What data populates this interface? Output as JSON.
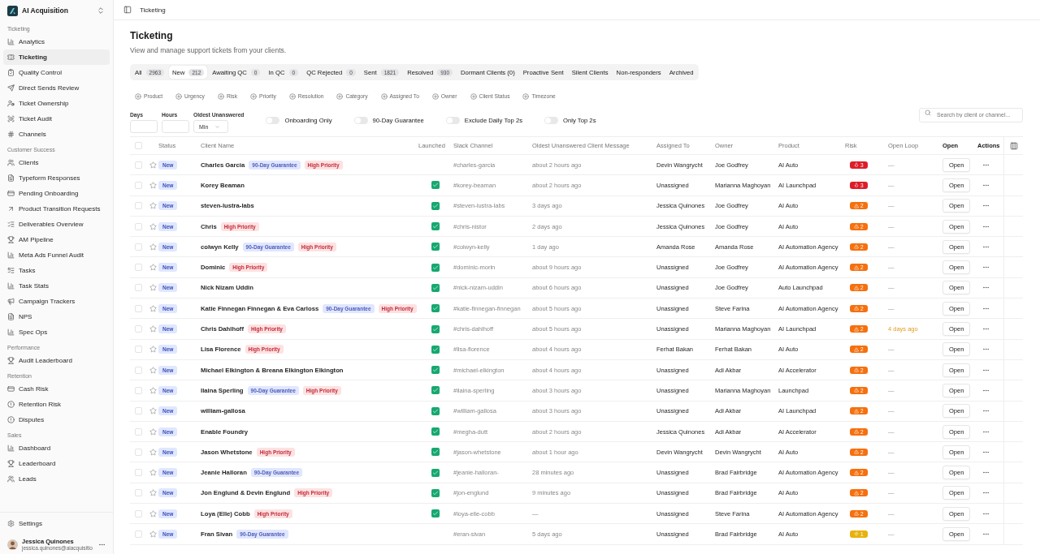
{
  "workspace": {
    "name": "AI Acquisition"
  },
  "breadcrumb": "Ticketing",
  "sidebar": {
    "sections": [
      {
        "title": "Ticketing",
        "items": [
          {
            "label": "Analytics",
            "selected": false
          },
          {
            "label": "Ticketing",
            "selected": true
          },
          {
            "label": "Quality Control",
            "selected": false
          },
          {
            "label": "Direct Sends Review",
            "selected": false
          },
          {
            "label": "Ticket Ownership",
            "selected": false
          },
          {
            "label": "Ticket Audit",
            "selected": false
          },
          {
            "label": "Channels",
            "selected": false
          }
        ]
      },
      {
        "title": "Customer Success",
        "items": [
          {
            "label": "Clients",
            "selected": false
          },
          {
            "label": "Typeform Responses",
            "selected": false
          },
          {
            "label": "Pending Onboarding",
            "selected": false
          },
          {
            "label": "Product Transition Requests",
            "selected": false
          },
          {
            "label": "Deliverables Overview",
            "selected": false
          },
          {
            "label": "AM Pipeline",
            "selected": false
          },
          {
            "label": "Meta Ads Funnel Audit",
            "selected": false
          },
          {
            "label": "Tasks",
            "selected": false
          },
          {
            "label": "Task Stats",
            "selected": false
          },
          {
            "label": "Campaign Trackers",
            "selected": false
          },
          {
            "label": "NPS",
            "selected": false
          },
          {
            "label": "Spec Ops",
            "selected": false
          }
        ]
      },
      {
        "title": "Performance",
        "items": [
          {
            "label": "Audit Leaderboard",
            "selected": false
          }
        ]
      },
      {
        "title": "Retention",
        "items": [
          {
            "label": "Cash Risk",
            "selected": false
          },
          {
            "label": "Retention Risk",
            "selected": false
          },
          {
            "label": "Disputes",
            "selected": false
          }
        ]
      },
      {
        "title": "Sales",
        "items": [
          {
            "label": "Dashboard",
            "selected": false
          },
          {
            "label": "Leaderboard",
            "selected": false
          },
          {
            "label": "Leads",
            "selected": false
          }
        ]
      }
    ],
    "settings": "Settings",
    "user": {
      "name": "Jessica Quinones",
      "email": "jessica.quinones@aiacquisitio"
    }
  },
  "page": {
    "title": "Ticketing",
    "subtitle": "View and manage support tickets from your clients."
  },
  "tabs": [
    {
      "label": "All",
      "count": "2963",
      "selected": false
    },
    {
      "label": "New",
      "count": "212",
      "selected": true
    },
    {
      "label": "Awaiting QC",
      "count": "0",
      "selected": false
    },
    {
      "label": "In QC",
      "count": "0",
      "selected": false
    },
    {
      "label": "QC Rejected",
      "count": "0",
      "selected": false
    },
    {
      "label": "Sent",
      "count": "1821",
      "selected": false
    },
    {
      "label": "Resolved",
      "count": "930",
      "selected": false
    },
    {
      "label": "Dormant Clients (0)",
      "selected": false
    },
    {
      "label": "Proactive Sent",
      "selected": false
    },
    {
      "label": "Silent Clients",
      "selected": false
    },
    {
      "label": "Non-responders",
      "selected": false
    },
    {
      "label": "Archived",
      "selected": false
    }
  ],
  "filters": [
    "Product",
    "Urgency",
    "Risk",
    "Priority",
    "Resolution",
    "Category",
    "Assigned To",
    "Owner",
    "Client Status",
    "Timezone"
  ],
  "range": {
    "days_label": "Days",
    "hours_label": "Hours",
    "oldest_label": "Oldest Unanswered",
    "oldest_value": "Min"
  },
  "toggles": [
    {
      "label": "Onboarding Only",
      "on": false
    },
    {
      "label": "90-Day Guarantee",
      "on": false
    },
    {
      "label": "Exclude Daily Top 2s",
      "on": false
    },
    {
      "label": "Only Top 2s",
      "on": false
    }
  ],
  "search": {
    "placeholder": "Search by client or channel..."
  },
  "table": {
    "select_all": false,
    "columns": [
      "Status",
      "Client Name",
      "Launched",
      "Slack Channel",
      "Oldest Unanswered Client Message",
      "Assigned To",
      "Owner",
      "Product",
      "Risk",
      "Open Loop",
      "Open",
      "Actions"
    ],
    "rows": [
      {
        "selected": false,
        "starred": false,
        "status": "New",
        "name": "Charles Garcia",
        "tags": [
          {
            "label": "90-Day Guarantee",
            "kind": "guarantee"
          },
          {
            "label": "High Priority",
            "kind": "priority"
          }
        ],
        "launched": false,
        "channel": "#charles-garcia",
        "oldest": "about 2 hours ago",
        "assigned": "Devin Wangrycht",
        "owner": "Joe Godfrey",
        "product": "AI Auto",
        "risk": {
          "kind": "critical",
          "value": "3"
        },
        "open_loop": {
          "text": "—",
          "overdue": false
        },
        "action": "Open"
      },
      {
        "selected": false,
        "starred": false,
        "status": "New",
        "name": "Korey Beaman",
        "tags": [],
        "launched": true,
        "channel": "#korey-beaman",
        "oldest": "about 2 hours ago",
        "assigned": "Unassigned",
        "owner": "Marianna Maghoyan",
        "product": "AI Launchpad",
        "risk": {
          "kind": "critical",
          "value": "3"
        },
        "open_loop": {
          "text": "—",
          "overdue": false
        },
        "action": "Open"
      },
      {
        "selected": false,
        "starred": false,
        "status": "New",
        "name": "steven-lustra-labs",
        "tags": [],
        "launched": true,
        "channel": "#steven-lustra-labs",
        "oldest": "3 days ago",
        "assigned": "Jessica Quinones",
        "owner": "Joe Godfrey",
        "product": "AI Auto",
        "risk": {
          "kind": "high",
          "value": "2"
        },
        "open_loop": {
          "text": "—",
          "overdue": false
        },
        "action": "Open"
      },
      {
        "selected": false,
        "starred": false,
        "status": "New",
        "name": "Chris",
        "tags": [
          {
            "label": "High Priority",
            "kind": "priority"
          }
        ],
        "launched": true,
        "channel": "#chris-nistor",
        "oldest": "2 days ago",
        "assigned": "Jessica Quinones",
        "owner": "Joe Godfrey",
        "product": "AI Auto",
        "risk": {
          "kind": "high",
          "value": "2"
        },
        "open_loop": {
          "text": "—",
          "overdue": false
        },
        "action": "Open"
      },
      {
        "selected": false,
        "starred": false,
        "status": "New",
        "name": "colwyn Kelly",
        "tags": [
          {
            "label": "90-Day Guarantee",
            "kind": "guarantee"
          },
          {
            "label": "High Priority",
            "kind": "priority"
          }
        ],
        "launched": true,
        "channel": "#colwyn-kelly",
        "oldest": "1 day ago",
        "assigned": "Amanda Rose",
        "owner": "Amanda Rose",
        "product": "AI Automation Agency",
        "risk": {
          "kind": "high",
          "value": "2"
        },
        "open_loop": {
          "text": "—",
          "overdue": false
        },
        "action": "Open"
      },
      {
        "selected": false,
        "starred": false,
        "status": "New",
        "name": "Dominic",
        "tags": [
          {
            "label": "High Priority",
            "kind": "priority"
          }
        ],
        "launched": true,
        "channel": "#dominic-morin",
        "oldest": "about 9 hours ago",
        "assigned": "Unassigned",
        "owner": "Joe Godfrey",
        "product": "AI Automation Agency",
        "risk": {
          "kind": "high",
          "value": "2"
        },
        "open_loop": {
          "text": "—",
          "overdue": false
        },
        "action": "Open"
      },
      {
        "selected": false,
        "starred": false,
        "status": "New",
        "name": "Nick Nizam Uddin",
        "tags": [],
        "launched": true,
        "channel": "#nick-nizam-uddin",
        "oldest": "about 6 hours ago",
        "assigned": "Unassigned",
        "owner": "Joe Godfrey",
        "product": "Auto Launchpad",
        "risk": {
          "kind": "high",
          "value": "2"
        },
        "open_loop": {
          "text": "—",
          "overdue": false
        },
        "action": "Open"
      },
      {
        "selected": false,
        "starred": false,
        "status": "New",
        "name": "Katie Finnegan Finnegan & Eva Carloss",
        "tags": [
          {
            "label": "90-Day Guarantee",
            "kind": "guarantee"
          },
          {
            "label": "High Priority",
            "kind": "priority"
          }
        ],
        "launched": true,
        "channel": "#katie-finnegan-finnegan",
        "oldest": "about 5 hours ago",
        "assigned": "Unassigned",
        "owner": "Steve Farina",
        "product": "AI Automation Agency",
        "risk": {
          "kind": "high",
          "value": "2"
        },
        "open_loop": {
          "text": "—",
          "overdue": false
        },
        "action": "Open"
      },
      {
        "selected": false,
        "starred": false,
        "status": "New",
        "name": "Chris Dahlhoff",
        "tags": [
          {
            "label": "High Priority",
            "kind": "priority"
          }
        ],
        "launched": true,
        "channel": "#chris-dahlhoff",
        "oldest": "about 5 hours ago",
        "assigned": "Unassigned",
        "owner": "Marianna Maghoyan",
        "product": "AI Launchpad",
        "risk": {
          "kind": "high",
          "value": "2"
        },
        "open_loop": {
          "text": "4 days ago",
          "overdue": true
        },
        "action": "Open"
      },
      {
        "selected": false,
        "starred": false,
        "status": "New",
        "name": "Lisa Florence",
        "tags": [
          {
            "label": "High Priority",
            "kind": "priority"
          }
        ],
        "launched": true,
        "channel": "#lisa-florence",
        "oldest": "about 4 hours ago",
        "assigned": "Ferhat Bakan",
        "owner": "Ferhat Bakan",
        "product": "AI Auto",
        "risk": {
          "kind": "high",
          "value": "2"
        },
        "open_loop": {
          "text": "—",
          "overdue": false
        },
        "action": "Open"
      },
      {
        "selected": false,
        "starred": false,
        "status": "New",
        "name": "Michael Elkington & Breana Elkington Elkington",
        "tags": [],
        "launched": true,
        "channel": "#michael-elkington",
        "oldest": "about 4 hours ago",
        "assigned": "Unassigned",
        "owner": "Adi Akbar",
        "product": "AI Accelerator",
        "risk": {
          "kind": "high",
          "value": "2"
        },
        "open_loop": {
          "text": "—",
          "overdue": false
        },
        "action": "Open"
      },
      {
        "selected": false,
        "starred": false,
        "status": "New",
        "name": "Ilaina Sperling",
        "tags": [
          {
            "label": "90-Day Guarantee",
            "kind": "guarantee"
          },
          {
            "label": "High Priority",
            "kind": "priority"
          }
        ],
        "launched": true,
        "channel": "#ilaina-sperling",
        "oldest": "about 3 hours ago",
        "assigned": "Unassigned",
        "owner": "Marianna Maghoyan",
        "product": "Launchpad",
        "risk": {
          "kind": "high",
          "value": "2"
        },
        "open_loop": {
          "text": "—",
          "overdue": false
        },
        "action": "Open"
      },
      {
        "selected": false,
        "starred": false,
        "status": "New",
        "name": "william-gallosa",
        "tags": [],
        "launched": true,
        "channel": "#william-gallosa",
        "oldest": "about 3 hours ago",
        "assigned": "Unassigned",
        "owner": "Adi Akbar",
        "product": "AI Launchpad",
        "risk": {
          "kind": "high",
          "value": "2"
        },
        "open_loop": {
          "text": "—",
          "overdue": false
        },
        "action": "Open"
      },
      {
        "selected": false,
        "starred": false,
        "status": "New",
        "name": "Enable Foundry",
        "tags": [],
        "launched": true,
        "channel": "#megha-dutt",
        "oldest": "about 2 hours ago",
        "assigned": "Jessica Quinones",
        "owner": "Adi Akbar",
        "product": "AI Accelerator",
        "risk": {
          "kind": "high",
          "value": "2"
        },
        "open_loop": {
          "text": "—",
          "overdue": false
        },
        "action": "Open"
      },
      {
        "selected": false,
        "starred": false,
        "status": "New",
        "name": "Jason Whetstone",
        "tags": [
          {
            "label": "High Priority",
            "kind": "priority"
          }
        ],
        "launched": true,
        "channel": "#jason-whetstone",
        "oldest": "about 1 hour ago",
        "assigned": "Devin Wangrycht",
        "owner": "Devin Wangrycht",
        "product": "AI Auto",
        "risk": {
          "kind": "high",
          "value": "2"
        },
        "open_loop": {
          "text": "—",
          "overdue": false
        },
        "action": "Open"
      },
      {
        "selected": false,
        "starred": false,
        "status": "New",
        "name": "Jeanie Halloran",
        "tags": [
          {
            "label": "90-Day Guarantee",
            "kind": "guarantee"
          }
        ],
        "launched": true,
        "channel": "#jeanie-halloran-",
        "oldest": "28 minutes ago",
        "assigned": "Unassigned",
        "owner": "Brad Fairbridge",
        "product": "AI Automation Agency",
        "risk": {
          "kind": "high",
          "value": "2"
        },
        "open_loop": {
          "text": "—",
          "overdue": false
        },
        "action": "Open"
      },
      {
        "selected": false,
        "starred": false,
        "status": "New",
        "name": "Jon Englund & Devin Englund",
        "tags": [
          {
            "label": "High Priority",
            "kind": "priority"
          }
        ],
        "launched": true,
        "channel": "#jon-englund",
        "oldest": "9 minutes ago",
        "assigned": "Unassigned",
        "owner": "Brad Fairbridge",
        "product": "AI Auto",
        "risk": {
          "kind": "high",
          "value": "2"
        },
        "open_loop": {
          "text": "—",
          "overdue": false
        },
        "action": "Open"
      },
      {
        "selected": false,
        "starred": false,
        "status": "New",
        "name": "Loya (Elle) Cobb",
        "tags": [
          {
            "label": "High Priority",
            "kind": "priority"
          }
        ],
        "launched": true,
        "channel": "#loya-elle-cobb",
        "oldest": "—",
        "assigned": "Unassigned",
        "owner": "Steve Farina",
        "product": "AI Automation Agency",
        "risk": {
          "kind": "high",
          "value": "2"
        },
        "open_loop": {
          "text": "—",
          "overdue": false
        },
        "action": "Open"
      },
      {
        "selected": false,
        "starred": false,
        "status": "New",
        "name": "Fran Sivan",
        "tags": [
          {
            "label": "90-Day Guarantee",
            "kind": "guarantee"
          }
        ],
        "launched": false,
        "channel": "#eran-sivan",
        "oldest": "5 days ago",
        "assigned": "Unassigned",
        "owner": "Brad Fairbridge",
        "product": "AI Auto",
        "risk": {
          "kind": "medium",
          "value": "1"
        },
        "open_loop": {
          "text": "—",
          "overdue": false
        },
        "action": "Open"
      }
    ]
  }
}
